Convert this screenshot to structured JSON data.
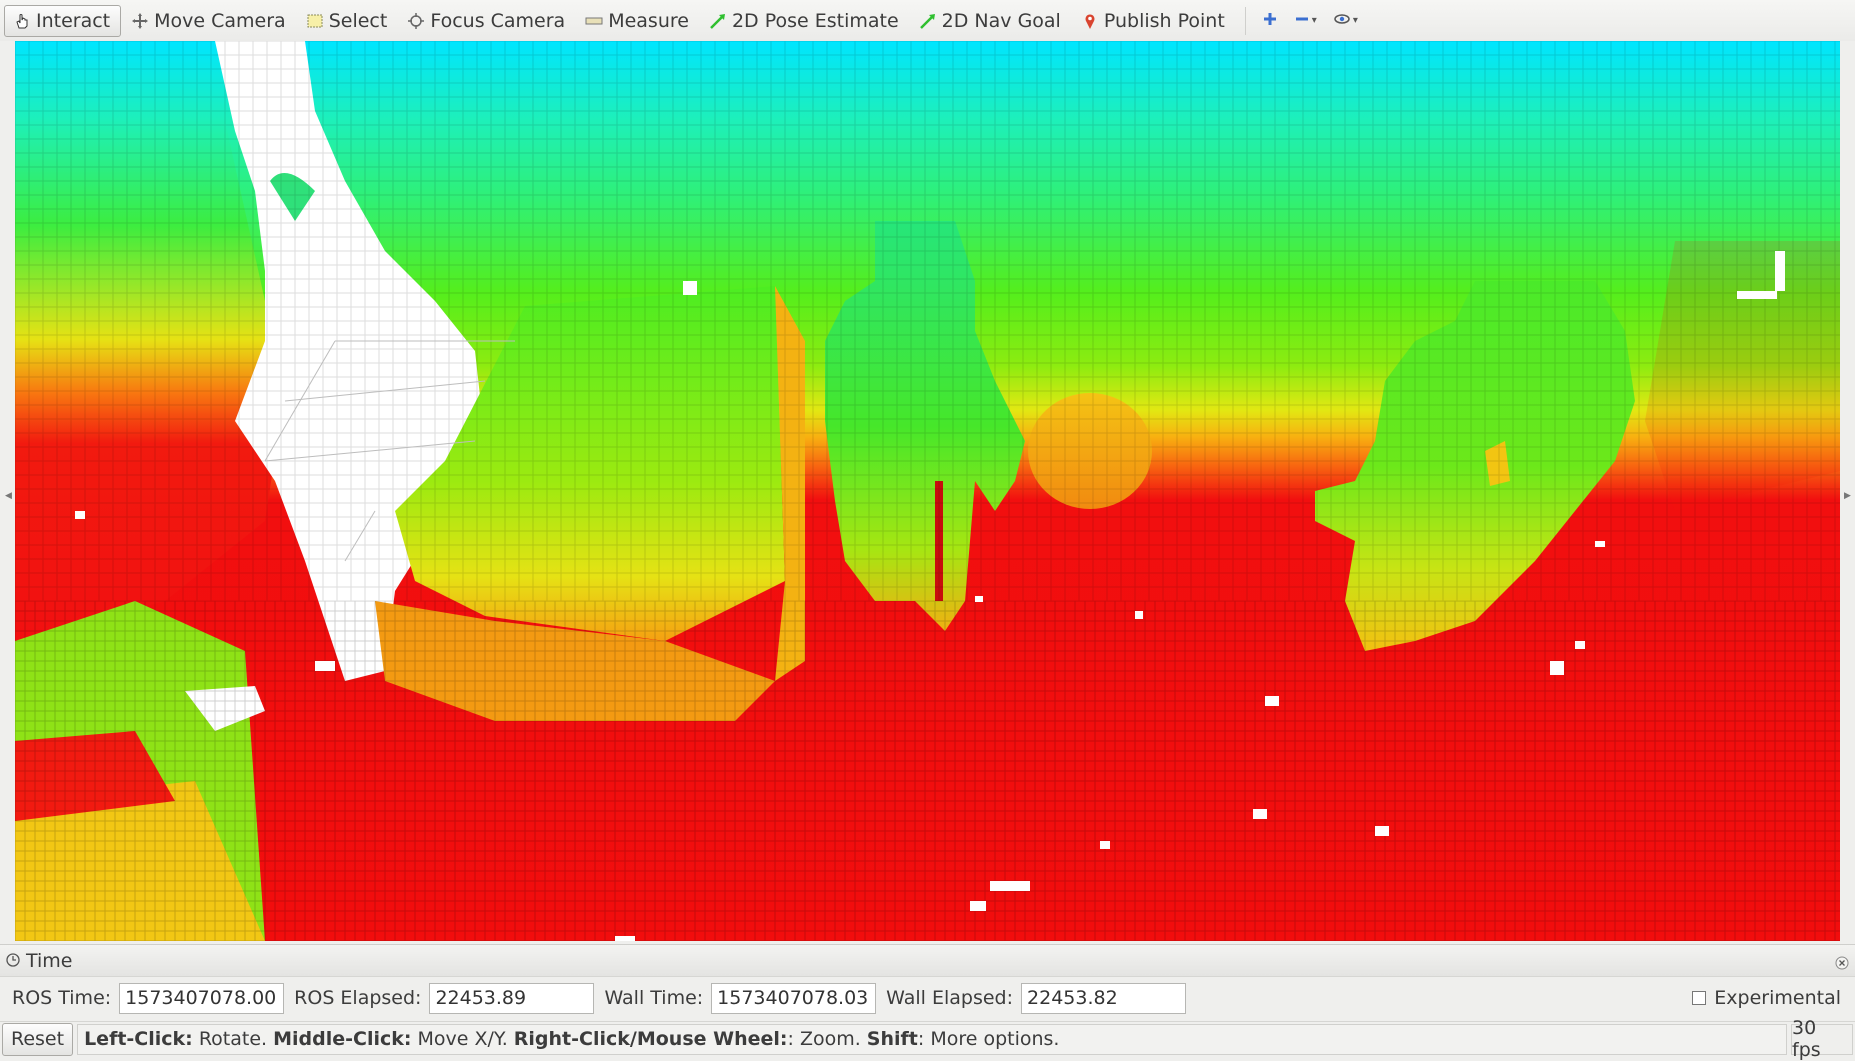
{
  "toolbar": {
    "tools": [
      {
        "label": "Interact",
        "icon": "hand-pointer-icon",
        "active": true
      },
      {
        "label": "Move Camera",
        "icon": "move-camera-icon"
      },
      {
        "label": "Select",
        "icon": "select-box-icon"
      },
      {
        "label": "Focus Camera",
        "icon": "focus-camera-icon"
      },
      {
        "label": "Measure",
        "icon": "ruler-icon"
      },
      {
        "label": "2D Pose Estimate",
        "icon": "green-arrow-icon"
      },
      {
        "label": "2D Nav Goal",
        "icon": "green-arrow-icon"
      },
      {
        "label": "Publish Point",
        "icon": "map-pin-icon"
      }
    ],
    "extra_icons": [
      "add-tool-icon",
      "remove-tool-icon",
      "view-options-icon"
    ]
  },
  "viewport": {
    "description_colors": {
      "top": "#00e5ff",
      "mid": "#55ee1c",
      "low": "#f8b010",
      "bottom": "#f20d0d",
      "free_space": "#ffffff"
    }
  },
  "time_panel": {
    "title": "Time",
    "ros_time_label": "ROS Time:",
    "ros_time_value": "1573407078.00",
    "ros_elapsed_label": "ROS Elapsed:",
    "ros_elapsed_value": "22453.89",
    "wall_time_label": "Wall Time:",
    "wall_time_value": "1573407078.03",
    "wall_elapsed_label": "Wall Elapsed:",
    "wall_elapsed_value": "22453.82",
    "experimental_label": "Experimental",
    "experimental_checked": false
  },
  "statusbar": {
    "reset_label": "Reset",
    "hint_1_key": "Left-Click:",
    "hint_1_text": " Rotate. ",
    "hint_2_key": "Middle-Click:",
    "hint_2_text": " Move X/Y. ",
    "hint_3_key": "Right-Click/Mouse Wheel:",
    "hint_3_text": ": Zoom. ",
    "hint_4_key": "Shift",
    "hint_4_text": ": More options.",
    "fps": "30 fps"
  }
}
